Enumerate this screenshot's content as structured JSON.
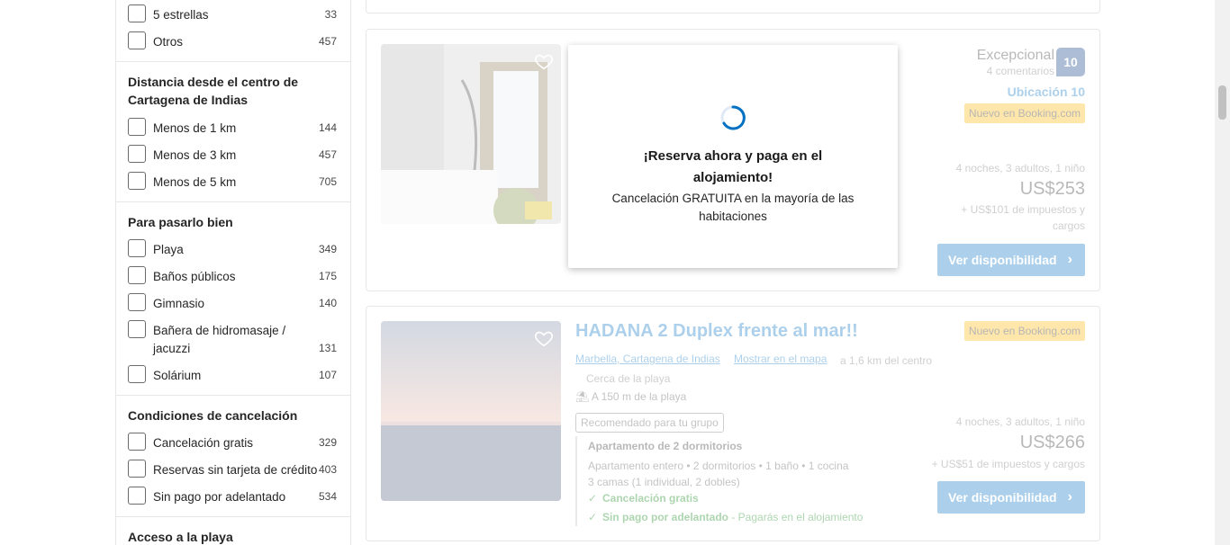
{
  "sidebar": {
    "stars_section": {
      "items": [
        {
          "label": "5 estrellas",
          "count": "33"
        },
        {
          "label": "Otros",
          "count": "457"
        }
      ]
    },
    "distance_section": {
      "title": "Distancia desde el centro de Cartagena de Indias",
      "title_line1": "Distancia desde el centro de",
      "title_line2": "Cartagena de Indias",
      "items": [
        {
          "label": "Menos de 1 km",
          "count": "144"
        },
        {
          "label": "Menos de 3 km",
          "count": "457"
        },
        {
          "label": "Menos de 5 km",
          "count": "705"
        }
      ]
    },
    "fun_section": {
      "title": "Para pasarlo bien",
      "items": [
        {
          "label": "Playa",
          "count": "349"
        },
        {
          "label": "Baños públicos",
          "count": "175"
        },
        {
          "label": "Gimnasio",
          "count": "140"
        },
        {
          "label_line1": "Bañera de hidromasaje /",
          "label_line2": "jacuzzi",
          "count": "131"
        },
        {
          "label": "Solárium",
          "count": "107"
        }
      ]
    },
    "cancel_section": {
      "title": "Condiciones de cancelación",
      "items": [
        {
          "label": "Cancelación gratis",
          "count": "329"
        },
        {
          "label": "Reservas sin tarjeta de crédito",
          "count": "403"
        },
        {
          "label": "Sin pago por adelantado",
          "count": "534"
        }
      ]
    },
    "beach_section": {
      "title": "Acceso a la playa"
    }
  },
  "card1": {
    "score_word": "Excepcional",
    "reviews": "4 comentarios",
    "score": "10",
    "location_score": "Ubicación 10",
    "new_badge": "Nuevo en Booking.com",
    "stay_info": "4 noches, 3 adultos, 1 niño",
    "price": "US$253",
    "taxes_line1": "+ US$101 de impuestos y",
    "taxes_line2": "cargos",
    "button": "Ver disponibilidad"
  },
  "popup": {
    "title_line1": "¡Reserva ahora y paga en el",
    "title_line2": "alojamiento!",
    "sub_line1": "Cancelación GRATUITA en la mayoría de las",
    "sub_line2": "habitaciones"
  },
  "card2": {
    "title": "HADANA 2 Duplex frente al mar!!",
    "location_link": "Marbella, Cartagena de Indias",
    "map_link": "Mostrar en el mapa",
    "distance": "a 1,6 km del centro",
    "near_beach": "Cerca de la playa",
    "beach_distance": "A 150 m de la playa",
    "group_badge": "Recomendado para tu grupo",
    "room_title": "Apartamento de 2 dormitorios",
    "room_details": "Apartamento entero • 2 dormitorios • 1 baño • 1 cocina",
    "beds": "3 camas (1 individual, 2 dobles)",
    "free_cancel": "Cancelación gratis",
    "no_prepay": "Sin pago por adelantado",
    "no_prepay_note": " - Pagarás en el alojamiento",
    "new_badge": "Nuevo en Booking.com",
    "stay_info": "4 noches, 3 adultos, 1 niño",
    "price": "US$266",
    "taxes": "+ US$51 de impuestos y cargos",
    "button": "Ver disponibilidad"
  },
  "colors": {
    "brand_blue": "#0071c2",
    "score_navy": "#003580",
    "badge_yellow": "#ffb700",
    "green": "#008009"
  }
}
